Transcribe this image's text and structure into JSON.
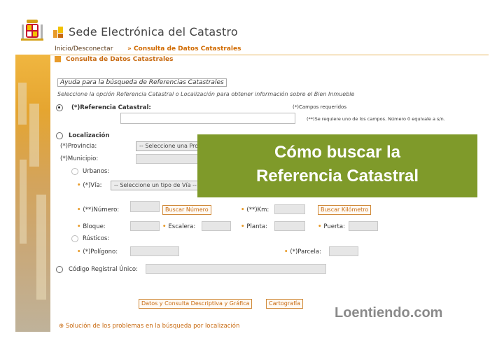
{
  "header": {
    "title": "Sede Electrónica del Catastro",
    "crest_icon": "spain-coat-of-arms-icon",
    "logo_icon": "catastro-logo-icon"
  },
  "nav": {
    "items": [
      {
        "label": "Inicio/Desconectar",
        "active": false
      },
      {
        "label": "» Consulta de Datos Catastrales",
        "active": true
      }
    ]
  },
  "section": {
    "title": "Consulta de Datos Catastrales"
  },
  "form": {
    "help_link": "Ayuda para la búsqueda de Referencias Catastrales",
    "instructions": "Seleccione la opción Referencia Catastral o Localización para obtener información sobre el Bien Inmueble",
    "required_note": "(*)Campos requeridos",
    "one_required_note": "(**)Se requiere uno de los campos. Número 0 equivale a s/n.",
    "ref_catastral": {
      "label": "(*)Referencia Catastral:",
      "value": ""
    },
    "localizacion": {
      "label": "Localización"
    },
    "provincia": {
      "label": "(*)Provincia:",
      "selected": "-- Seleccione una Provincia --"
    },
    "municipio": {
      "label": "(*)Municipio:"
    },
    "urbanos": {
      "label": "Urbanos:"
    },
    "via": {
      "label": "(*)Vía:",
      "selected": "-- Seleccione un tipo de Vía --"
    },
    "numero": {
      "label": "(**)Número:",
      "button": "Buscar Número"
    },
    "km": {
      "label": "(**)Km:",
      "button": "Buscar Kilómetro"
    },
    "bloque": {
      "label": "Bloque:"
    },
    "escalera": {
      "label": "Escalera:"
    },
    "planta": {
      "label": "Planta:"
    },
    "puerta": {
      "label": "Puerta:"
    },
    "rusticos": {
      "label": "Rústicos:"
    },
    "poligono": {
      "label": "(*)Polígono:"
    },
    "parcela": {
      "label": "(*)Parcela:"
    },
    "cru": {
      "label": "Código Registral Único:"
    },
    "submit_button": "Datos y Consulta Descriptiva y Gráfica",
    "carto_button": "Cartografía",
    "footer_note": "Solución de los problemas en la búsqueda por localización"
  },
  "overlay": {
    "line1": "Cómo buscar la",
    "line2": "Referencia Catastral",
    "color": "#7f9a2a"
  },
  "watermark": "Loentiendo.com"
}
